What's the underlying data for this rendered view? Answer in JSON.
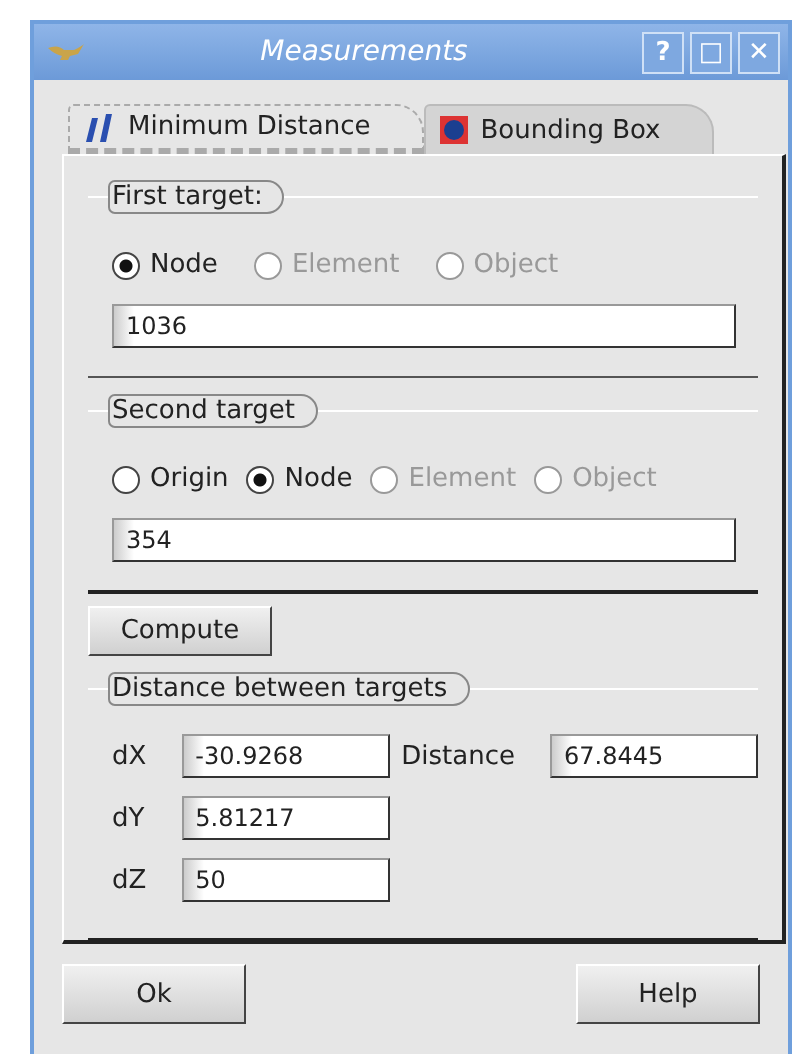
{
  "window": {
    "title": "Measurements",
    "buttons": [
      "?",
      "□",
      "✕"
    ]
  },
  "tabs": [
    {
      "label": "Minimum Distance",
      "selected": true
    },
    {
      "label": "Bounding Box",
      "selected": false
    }
  ],
  "first_target": {
    "title": "First target:",
    "options": [
      {
        "label": "Node",
        "selected": true,
        "disabled": false
      },
      {
        "label": "Element",
        "selected": false,
        "disabled": true
      },
      {
        "label": "Object",
        "selected": false,
        "disabled": true
      }
    ],
    "value": "1036"
  },
  "second_target": {
    "title": "Second target",
    "options": [
      {
        "label": "Origin",
        "selected": false,
        "disabled": false
      },
      {
        "label": "Node",
        "selected": true,
        "disabled": false
      },
      {
        "label": "Element",
        "selected": false,
        "disabled": true
      },
      {
        "label": "Object",
        "selected": false,
        "disabled": true
      }
    ],
    "value": "354"
  },
  "compute_button": "Compute",
  "distance": {
    "title": "Distance between targets",
    "dx": {
      "label": "dX",
      "value": "-30.9268"
    },
    "distance": {
      "label": "Distance",
      "value": "67.8445"
    },
    "dy": {
      "label": "dY",
      "value": "5.81217"
    },
    "dz": {
      "label": "dZ",
      "value": "50"
    }
  },
  "buttons": [
    "Ok",
    "Help"
  ]
}
